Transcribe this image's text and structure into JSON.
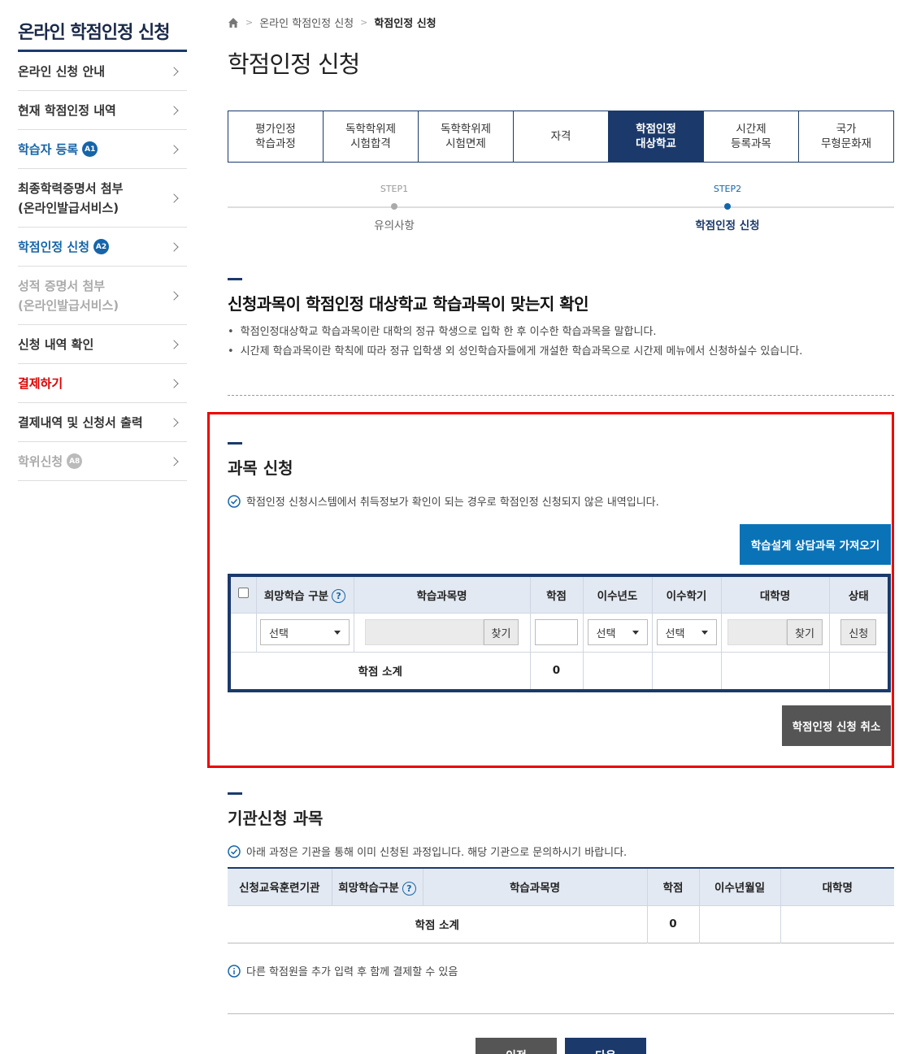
{
  "sidebar": {
    "title": "온라인 학점인정 신청",
    "items": [
      {
        "label": "온라인 신청 안내"
      },
      {
        "label": "현재 학점인정 내역"
      },
      {
        "label": "학습자 등록",
        "badge": "A1"
      },
      {
        "label": "최종학력증명서 첨부\n(온라인발급서비스)"
      },
      {
        "label": "학점인정 신청",
        "badge": "A2"
      },
      {
        "label": "성적 증명서 첨부\n(온라인발급서비스)"
      },
      {
        "label": "신청 내역 확인"
      },
      {
        "label": "결제하기"
      },
      {
        "label": "결제내역 및 신청서 출력"
      },
      {
        "label": "학위신청",
        "badge": "A8"
      }
    ]
  },
  "breadcrumb": {
    "level1": "온라인 학점인정 신청",
    "current": "학점인정 신청"
  },
  "page_title": "학점인정 신청",
  "tabs": [
    "평가인정\n학습과정",
    "독학학위제\n시험합격",
    "독학학위제\n시험면제",
    "자격",
    "학점인정\n대상학교",
    "시간제\n등록과목",
    "국가\n무형문화재"
  ],
  "steps": [
    {
      "no": "STEP1",
      "name": "유의사항"
    },
    {
      "no": "STEP2",
      "name": "학점인정 신청"
    }
  ],
  "section1": {
    "title": "신청과목이 학점인정 대상학교 학습과목이 맞는지 확인",
    "bullets": [
      "학점인정대상학교 학습과목이란 대학의 정규 학생으로 입학 한 후 이수한 학습과목을 말합니다.",
      "시간제 학습과목이란 학칙에 따라 정규 입학생 외 성인학습자들에게 개설한 학습과목으로 시간제 메뉴에서 신청하실수 있습니다."
    ]
  },
  "section2": {
    "title": "과목 신청",
    "note": "학점인정 신청시스템에서 취득정보가 확인이 되는 경우로 학점인정 신청되지 않은 내역입니다.",
    "import_button": "학습설계 상담과목 가져오기",
    "headers": [
      "희망학습 구분",
      "학습과목명",
      "학점",
      "이수년도",
      "이수학기",
      "대학명",
      "상태"
    ],
    "row": {
      "type_select": "선택",
      "find1": "찾기",
      "year_select": "선택",
      "term_select": "선택",
      "find2": "찾기",
      "apply": "신청"
    },
    "subtotal_label": "학점 소계",
    "subtotal_value": "0",
    "cancel_button": "학점인정 신청 취소"
  },
  "section3": {
    "title": "기관신청 과목",
    "note": "아래 과정은 기관을 통해 이미 신청된 과정입니다. 해당 기관으로 문의하시기 바랍니다.",
    "headers": [
      "신청교육훈련기관",
      "희망학습구분",
      "학습과목명",
      "학점",
      "이수년월일",
      "대학명"
    ],
    "subtotal_label": "학점 소계",
    "subtotal_value": "0",
    "info": "다른 학점원을 추가 입력 후 함께 결제할 수 있음"
  },
  "nav": {
    "prev": "이전",
    "next": "다음"
  },
  "colors": {
    "navy": "#1b3a6b",
    "blue": "#0a73b8",
    "highlight": "#ee0000"
  }
}
